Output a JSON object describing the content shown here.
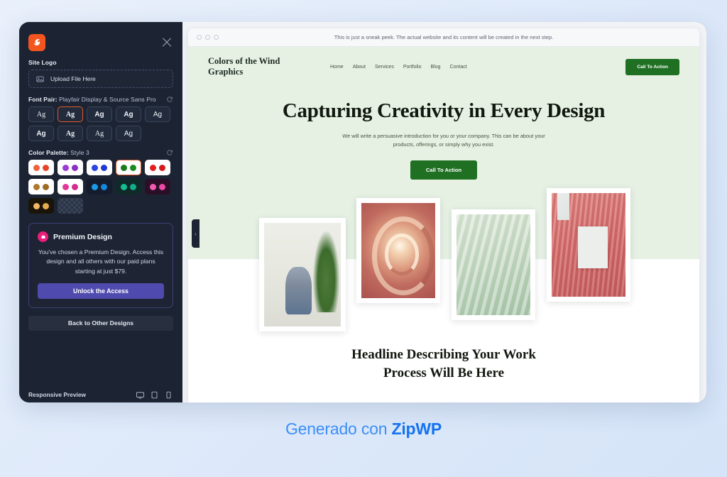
{
  "sidebar": {
    "logo_icon": "zipwp-comet-logo-icon",
    "close_icon": "close-icon",
    "site_logo_label": "Site Logo",
    "upload": {
      "text": "Upload File Here",
      "icon": "image-placeholder-icon"
    },
    "font_pair": {
      "label_prefix": "Font Pair:",
      "label_value": "Playfair Display & Source Sans Pro",
      "refresh_icon": "refresh-icon",
      "chips": [
        {
          "text": "Ag",
          "style": "serif",
          "selected": false
        },
        {
          "text": "Ag",
          "style": "serif-bold",
          "selected": true
        },
        {
          "text": "Ag",
          "style": "sans-bold",
          "selected": false
        },
        {
          "text": "Ag",
          "style": "sans-bold2",
          "selected": false
        },
        {
          "text": "Ag",
          "style": "sans",
          "selected": false
        },
        {
          "text": "Ag",
          "style": "sans-bold3",
          "selected": false
        },
        {
          "text": "Ag",
          "style": "serif-bold2",
          "selected": false
        },
        {
          "text": "Ag",
          "style": "serif2",
          "selected": false
        },
        {
          "text": "Ag",
          "style": "sans-light",
          "selected": false
        }
      ]
    },
    "color_palette": {
      "label_prefix": "Color Palette:",
      "label_value": "Style 3",
      "refresh_icon": "refresh-icon",
      "swatches": [
        {
          "bg": "#ffffff",
          "a": "#f0603c",
          "b": "#e8442a",
          "selected": false,
          "checker": false
        },
        {
          "bg": "#ffffff",
          "a": "#9b3cd4",
          "b": "#8a2fc4",
          "selected": false,
          "checker": false
        },
        {
          "bg": "#ffffff",
          "a": "#2b45df",
          "b": "#2238d0",
          "selected": false,
          "checker": false
        },
        {
          "bg": "#ffffff",
          "a": "#1a7a1e",
          "b": "#1e8a22",
          "selected": true,
          "checker": false
        },
        {
          "bg": "#ffffff",
          "a": "#e02020",
          "b": "#d41b1b",
          "selected": false,
          "checker": false
        },
        {
          "bg": "#ffffff",
          "a": "#b0782c",
          "b": "#9f6b24",
          "selected": false,
          "checker": false
        },
        {
          "bg": "#ffffff",
          "a": "#e0399a",
          "b": "#d22f8d",
          "selected": false,
          "checker": false
        },
        {
          "bg": "#141c2e",
          "a": "#1a9ae8",
          "b": "#1488dd",
          "selected": false,
          "checker": false
        },
        {
          "bg": "#0f2a28",
          "a": "#15bd96",
          "b": "#11ae89",
          "selected": false,
          "checker": false
        },
        {
          "bg": "#2a0f26",
          "a": "#f15bb0",
          "b": "#ea4aa5",
          "selected": false,
          "checker": false
        },
        {
          "bg": "#1a1408",
          "a": "#f0b860",
          "b": "#e5ab51",
          "selected": false,
          "checker": false
        },
        {
          "bg": "",
          "a": "",
          "b": "",
          "selected": false,
          "checker": true
        }
      ]
    },
    "premium": {
      "icon": "premium-badge-icon",
      "title": "Premium Design",
      "body": "You've chosen a Premium Design. Access this design and all others with our paid plans starting at just $79.",
      "button": "Unlock the Access"
    },
    "back_button": "Back to Other Designs",
    "responsive": {
      "label": "Responsive Preview",
      "devices": [
        "desktop-preview-icon",
        "tablet-preview-icon",
        "mobile-preview-icon"
      ]
    },
    "collapse_icon": "chevron-left-icon"
  },
  "preview": {
    "browser_note": "This is just a sneak peek. The actual website and its content will be created in the next step.",
    "traffic_lights": [
      "window-dot",
      "window-dot",
      "window-dot"
    ],
    "site": {
      "brand_line1": "Colors of the Wind",
      "brand_line2": "Graphics",
      "nav": [
        "Home",
        "About",
        "Services",
        "Portfolio",
        "Blog",
        "Contact"
      ],
      "header_cta": "Call To Action",
      "hero_title": "Capturing Creativity in Every Design",
      "hero_sub": "We will write a persuasive introduction for you or your company. This can be about your products, offerings, or simply why you exist.",
      "hero_cta": "Call To Action",
      "gallery": [
        {
          "name": "artist-studio-photo",
          "cls": "ph-studio"
        },
        {
          "name": "spiral-staircase-photo",
          "cls": "ph-stair"
        },
        {
          "name": "green-linen-photo",
          "cls": "ph-linen"
        },
        {
          "name": "pink-fur-frame-photo",
          "cls": "ph-fur"
        }
      ],
      "bottom_headline_line1": "Headline Describing Your Work",
      "bottom_headline_line2": "Process Will Be Here"
    }
  },
  "footer": {
    "prefix": "Generado con ",
    "brand": "ZipWP"
  },
  "colors": {
    "accent_orange": "#f4551f",
    "selection_orange": "#e05a2b",
    "premium_purple": "#4f4bae",
    "premium_pink": "#ec1d7c",
    "site_green": "#1f7023",
    "hero_bg_green": "#e6f1e4",
    "sidebar_bg": "#1c2433",
    "footer_blue": "#1572f0"
  }
}
